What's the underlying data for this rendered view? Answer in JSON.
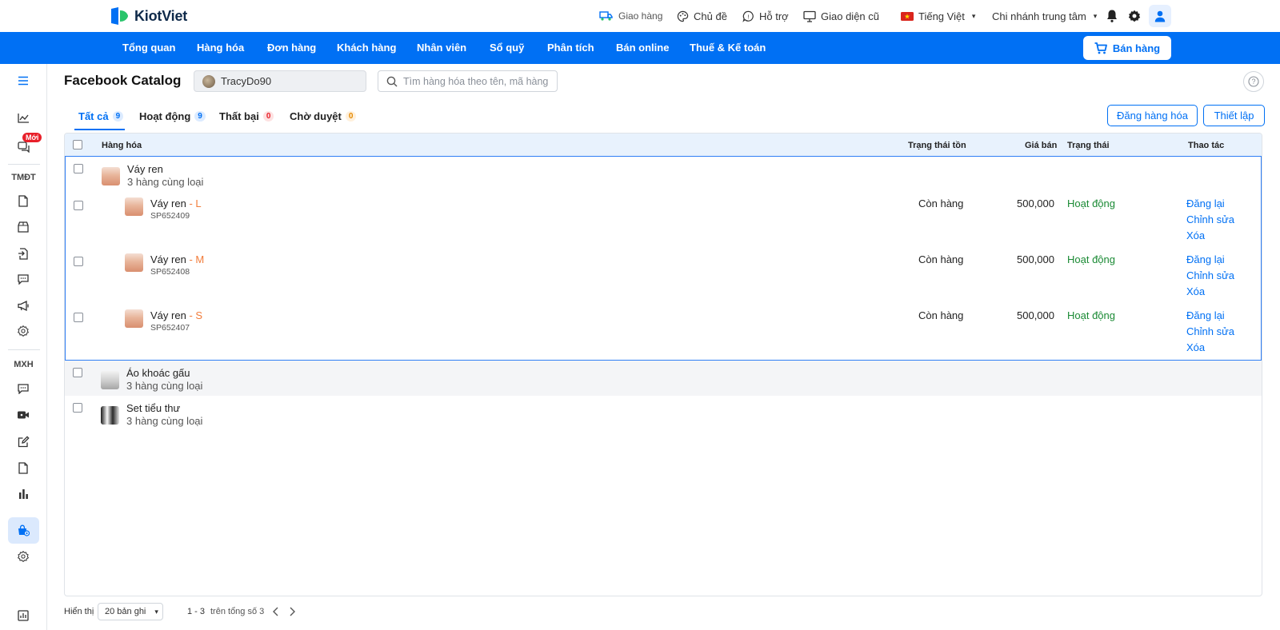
{
  "topbar": {
    "logo_text": "KiotViet",
    "delivery": "Giao hàng",
    "theme": "Chủ đề",
    "support": "Hỗ trợ",
    "old_ui": "Giao diện cũ",
    "language": "Tiếng Việt",
    "branch": "Chi nhánh trung tâm"
  },
  "nav": {
    "items": [
      "Tổng quan",
      "Hàng hóa",
      "Đơn hàng",
      "Khách hàng",
      "Nhân viên",
      "Sổ quỹ",
      "Phân tích",
      "Bán online",
      "Thuế & Kế toán"
    ],
    "sell_button": "Bán hàng"
  },
  "sidebar": {
    "badge_new": "Mới",
    "section_tmdt": "TMĐT",
    "section_mxh": "MXH"
  },
  "page": {
    "title": "Facebook Catalog",
    "account": "TracyDo90",
    "search_placeholder": "Tìm hàng hóa theo tên, mã hàng"
  },
  "tabs": [
    {
      "label": "Tất cả",
      "count": "9"
    },
    {
      "label": "Hoạt động",
      "count": "9"
    },
    {
      "label": "Thất bại",
      "count": "0"
    },
    {
      "label": "Chờ duyệt",
      "count": "0"
    }
  ],
  "actions": {
    "post_products": "Đăng hàng hóa",
    "settings": "Thiết lập"
  },
  "table": {
    "headers": {
      "product": "Hàng hóa",
      "stock_status": "Trạng thái tồn",
      "price": "Giá bán",
      "status": "Trạng thái",
      "actions": "Thao tác"
    },
    "groups": [
      {
        "name": "Váy ren",
        "sub": "3 hàng cùng loại",
        "variants": [
          {
            "name": "Váy ren",
            "size": "- L",
            "code": "SP652409",
            "stock": "Còn hàng",
            "price": "500,000",
            "status": "Hoạt động"
          },
          {
            "name": "Váy ren",
            "size": "- M",
            "code": "SP652408",
            "stock": "Còn hàng",
            "price": "500,000",
            "status": "Hoạt động"
          },
          {
            "name": "Váy ren",
            "size": "- S",
            "code": "SP652407",
            "stock": "Còn hàng",
            "price": "500,000",
            "status": "Hoạt động"
          }
        ]
      },
      {
        "name": "Áo khoác gấu",
        "sub": "3 hàng cùng loại"
      },
      {
        "name": "Set tiểu thư",
        "sub": "3 hàng cùng loại"
      }
    ],
    "row_actions": {
      "repost": "Đăng lại",
      "edit": "Chỉnh sửa",
      "delete": "Xóa"
    }
  },
  "footer": {
    "show_label": "Hiển thị",
    "page_size": "20 bản ghi",
    "range": "1 - 3",
    "total": "trên tổng số 3"
  },
  "colors": {
    "primary": "#0070f4",
    "active_status": "#1a8a34",
    "variant_size": "#f27c3a",
    "badge_red": "#e8202a"
  }
}
